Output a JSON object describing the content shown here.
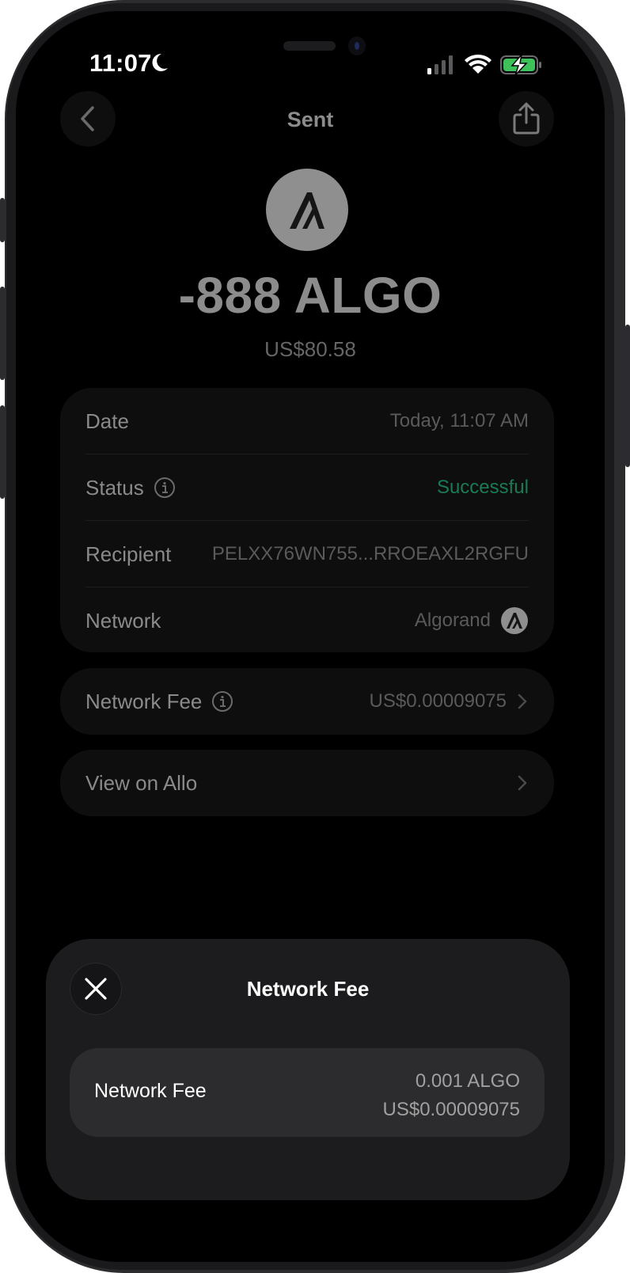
{
  "status_bar": {
    "time": "11:07"
  },
  "nav": {
    "title": "Sent"
  },
  "transaction": {
    "amount": "-888 ALGO",
    "fiat_value": "US$80.58",
    "details": [
      {
        "label": "Date",
        "value": "Today, 11:07 AM"
      },
      {
        "label": "Status",
        "value": "Successful"
      },
      {
        "label": "Recipient",
        "value": "PELXX76WN755...RROEAXL2RGFU"
      },
      {
        "label": "Network",
        "value": "Algorand"
      }
    ],
    "network_fee": {
      "label": "Network Fee",
      "value": "US$0.00009075"
    },
    "explorer": {
      "label": "View on Allo"
    }
  },
  "sheet": {
    "title": "Network Fee",
    "fee_label": "Network Fee",
    "fee_crypto": "0.001 ALGO",
    "fee_fiat": "US$0.00009075"
  },
  "colors": {
    "success": "#1b7a56",
    "background": "#000000"
  }
}
